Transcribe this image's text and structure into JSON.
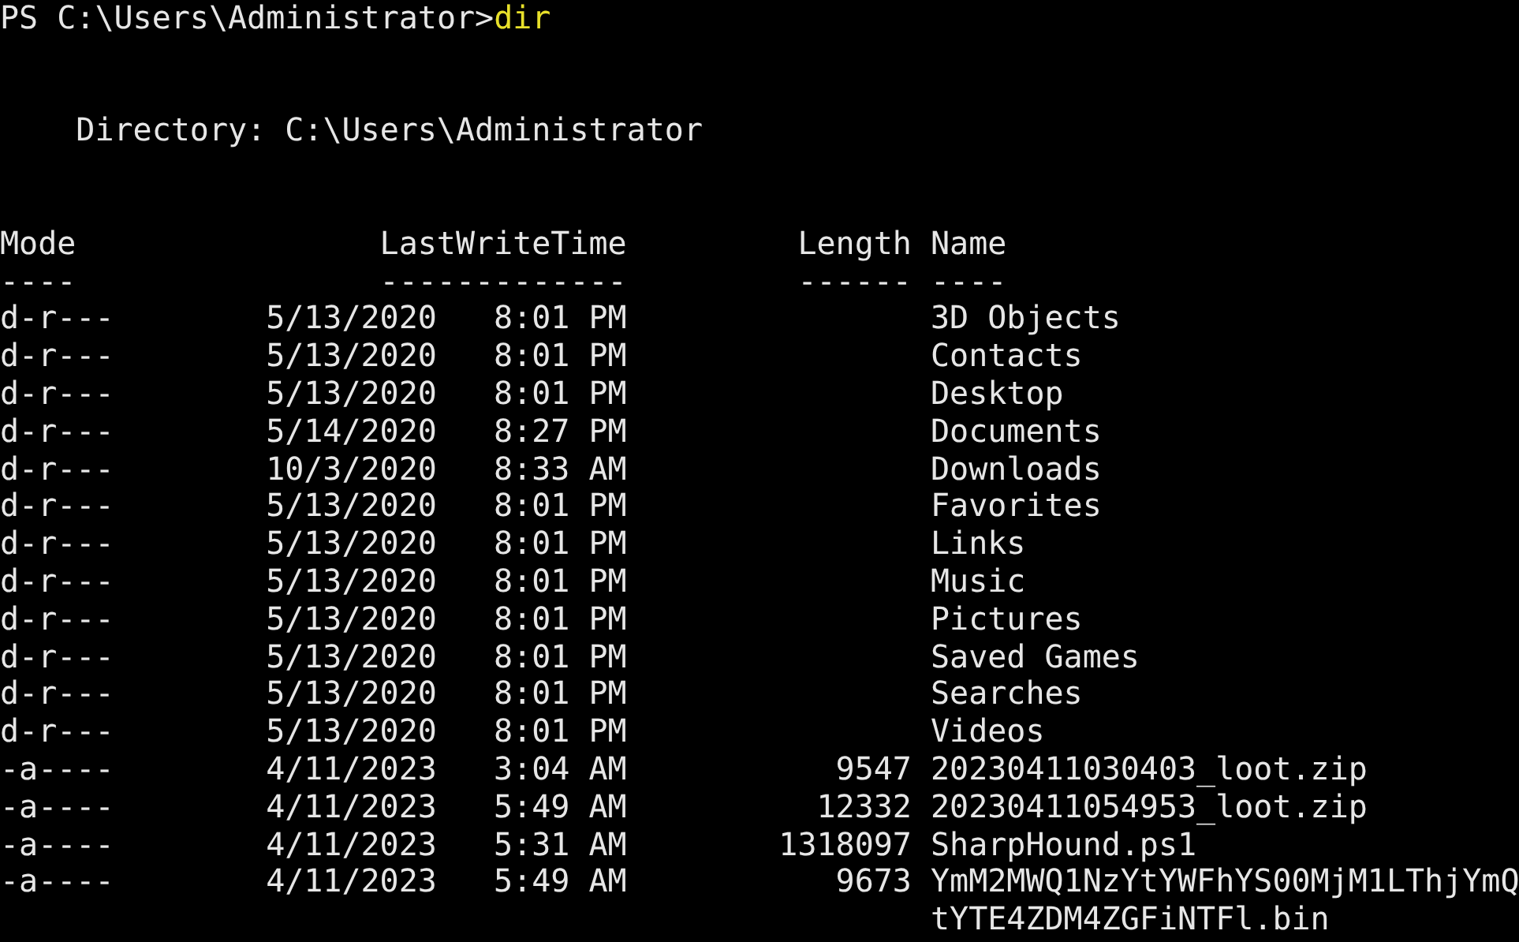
{
  "prompt": {
    "text": "PS C:\\Users\\Administrator>",
    "command": "dir"
  },
  "directory": "Directory: C:\\Users\\Administrator",
  "columns": [
    {
      "label": "Mode",
      "rule": "----"
    },
    {
      "label": "LastWriteTime",
      "rule": "-------------"
    },
    {
      "label": "Length",
      "rule": "------"
    },
    {
      "label": "Name",
      "rule": "----"
    }
  ],
  "rows": [
    {
      "mode": "d-r---",
      "date": "5/13/2020",
      "time": "8:01 PM",
      "length": "",
      "name": "3D Objects"
    },
    {
      "mode": "d-r---",
      "date": "5/13/2020",
      "time": "8:01 PM",
      "length": "",
      "name": "Contacts"
    },
    {
      "mode": "d-r---",
      "date": "5/13/2020",
      "time": "8:01 PM",
      "length": "",
      "name": "Desktop"
    },
    {
      "mode": "d-r---",
      "date": "5/14/2020",
      "time": "8:27 PM",
      "length": "",
      "name": "Documents"
    },
    {
      "mode": "d-r---",
      "date": "10/3/2020",
      "time": "8:33 AM",
      "length": "",
      "name": "Downloads"
    },
    {
      "mode": "d-r---",
      "date": "5/13/2020",
      "time": "8:01 PM",
      "length": "",
      "name": "Favorites"
    },
    {
      "mode": "d-r---",
      "date": "5/13/2020",
      "time": "8:01 PM",
      "length": "",
      "name": "Links"
    },
    {
      "mode": "d-r---",
      "date": "5/13/2020",
      "time": "8:01 PM",
      "length": "",
      "name": "Music"
    },
    {
      "mode": "d-r---",
      "date": "5/13/2020",
      "time": "8:01 PM",
      "length": "",
      "name": "Pictures"
    },
    {
      "mode": "d-r---",
      "date": "5/13/2020",
      "time": "8:01 PM",
      "length": "",
      "name": "Saved Games"
    },
    {
      "mode": "d-r---",
      "date": "5/13/2020",
      "time": "8:01 PM",
      "length": "",
      "name": "Searches"
    },
    {
      "mode": "d-r---",
      "date": "5/13/2020",
      "time": "8:01 PM",
      "length": "",
      "name": "Videos"
    },
    {
      "mode": "-a----",
      "date": "4/11/2023",
      "time": "3:04 AM",
      "length": "9547",
      "name": "20230411030403_loot.zip"
    },
    {
      "mode": "-a----",
      "date": "4/11/2023",
      "time": "5:49 AM",
      "length": "12332",
      "name": "20230411054953_loot.zip"
    },
    {
      "mode": "-a----",
      "date": "4/11/2023",
      "time": "5:31 AM",
      "length": "1318097",
      "name": "SharpHound.ps1"
    },
    {
      "mode": "-a----",
      "date": "4/11/2023",
      "time": "5:49 AM",
      "length": "9673",
      "name": "YmM2MWQ1NzYtYWFhYS00MjM1LThjYmQtYTE4ZDM4ZGFiNTFl.bin"
    }
  ]
}
